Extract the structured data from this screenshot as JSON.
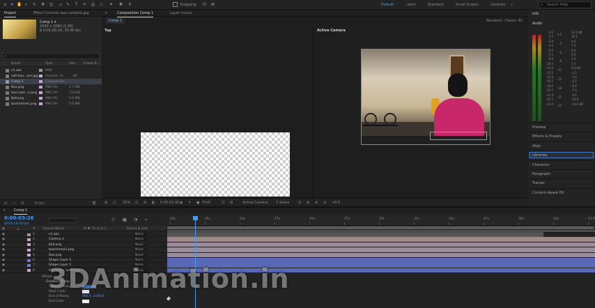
{
  "toolbar": {
    "snapping_label": "Snapping",
    "workspaces": [
      "Default",
      "Learn",
      "Standard",
      "Small Screen",
      "Libraries"
    ],
    "search_placeholder": "Search Help"
  },
  "project": {
    "tabs": [
      "Project",
      "Effect Controls lass-vampire.jpg"
    ],
    "comp_name": "Comp 1 ▾",
    "comp_size": "1920 x 1080 (1.00)",
    "comp_duration": "Δ 0;01;00;10, 30.00 fps",
    "columns": [
      "Name",
      "Type",
      "Size",
      "Frame R..."
    ],
    "items": [
      {
        "name": "v1.aac",
        "type": "MAV",
        "size": "",
        "color": "#9a9a9a"
      },
      {
        "name": "salt-hou...ere.jpg",
        "type": "Importe...G",
        "size": "... kB",
        "color": "#c8a8d8"
      },
      {
        "name": "Comp 1",
        "type": "Composition",
        "size": "",
        "color": "#c8a8d8"
      },
      {
        "name": "8oo.png",
        "type": "PNG file",
        "size": "1.7 MB",
        "color": "#c8a8d8"
      },
      {
        "name": "lass-vam...e.png",
        "type": "PNG file",
        "size": "719 KB",
        "color": "#c8a8d8"
      },
      {
        "name": "8all.png",
        "type": "PNG file",
        "size": "5.6 MB",
        "color": "#c8a8d8"
      },
      {
        "name": "backimme1.png",
        "type": "PNG file",
        "size": "5.6 MB",
        "color": "#c8a8d8"
      }
    ],
    "footer_bpc": "8 bpc"
  },
  "viewer": {
    "tabs": [
      "Composition Comp 1",
      "Layer (none)"
    ],
    "subtab": "Comp 1",
    "renderer": "Renderer:  Classic 3D",
    "left_label": "Top",
    "right_label": "Active Camera",
    "footer": {
      "zoom": "25%",
      "timecode": "0:00:03:26",
      "resolution": "(Full)",
      "camera": "Active Camera",
      "views": "2 Views",
      "exposure": "+0.0"
    }
  },
  "right_panel": {
    "info": "Info",
    "audio": "Audio",
    "meter_scale_left": [
      "0.0",
      "-1.5",
      "-3.0",
      "-4.5",
      "-6.0",
      "-7.5",
      "-9.0",
      "-10.5",
      "-12.0",
      "-13.5",
      "-15.0",
      "-16.5",
      "-18.0",
      "-19.5",
      "-21.0",
      "-22.5",
      "-24.0"
    ],
    "meter_scale_right": [
      "12.0 dB",
      "10.5",
      "9.0",
      "7.5",
      "6.0",
      "4.5",
      "3.0",
      "1.5",
      "0.0 dB",
      "-1.5",
      "-3.0",
      "-4.5",
      "-6.0",
      "-7.5",
      "-9.0",
      "-10.5",
      "-12.0 dB"
    ],
    "meter_scale_mid": [
      "0.0",
      "-3",
      "-6",
      "-9",
      "-12",
      "-15",
      "-18",
      "-21",
      "-24"
    ],
    "panels": [
      "Preview",
      "Effects & Presets",
      "Align",
      "Libraries",
      "Character",
      "Paragraph",
      "Tracker",
      "Content-Aware Fill"
    ]
  },
  "timeline": {
    "tab": "Comp 1",
    "timecode": "0:00:03:26",
    "fps": "00116 (30.00 fps)",
    "columns": [
      "Source Name",
      "Parent & Link"
    ],
    "ruler": [
      "00s",
      "05s",
      "10s",
      "15s",
      "20s",
      "25s",
      "30s",
      "35s",
      "40s",
      "45s",
      "50s",
      "55s",
      "01:00s"
    ],
    "layers": [
      {
        "num": "1",
        "name": "v1.aac",
        "parent": "None",
        "color": "#9a9a9a",
        "track": "#555555"
      },
      {
        "num": "2",
        "name": "Camera 1",
        "parent": "None",
        "color": "#d8a8a8",
        "track": "#9a8a8a"
      },
      {
        "num": "3",
        "name": "8all.png",
        "parent": "None",
        "color": "#c8a8d8",
        "track": "#9a8a9a"
      },
      {
        "num": "4",
        "name": "backimme1.png",
        "parent": "None",
        "color": "#c8a8d8",
        "track": "#9a8a9a"
      },
      {
        "num": "5",
        "name": "8oo.png",
        "parent": "None",
        "color": "#c8a8d8",
        "track": "#9a8a9a"
      },
      {
        "num": "6",
        "name": "Shape Layer 1",
        "parent": "None",
        "color": "#6a7ad8",
        "track": "#5a68b8"
      },
      {
        "num": "7",
        "name": "Shape Layer 1",
        "parent": "None",
        "color": "#6a7ad8",
        "track": "#5a68b8"
      },
      {
        "num": "8",
        "name": "lass-vam...nere.png",
        "parent": "None",
        "color": "#c8a8d8",
        "track": "#5a68b8"
      }
    ],
    "properties": {
      "effects": "Effects",
      "gradient_ramp": "Gradient Ramp",
      "start_of_ramp": "Start of Ramp",
      "start_color": "Start Color",
      "end_of_ramp": "End of Ramp",
      "end_of_ramp_value": "960.0, 2160.0",
      "end_color": "End Color"
    }
  },
  "watermark": "3DAnimation.in",
  "colors": {
    "accent": "#3d9bff",
    "work_area_green": "#2cc84a",
    "selection": "#3c4048"
  }
}
